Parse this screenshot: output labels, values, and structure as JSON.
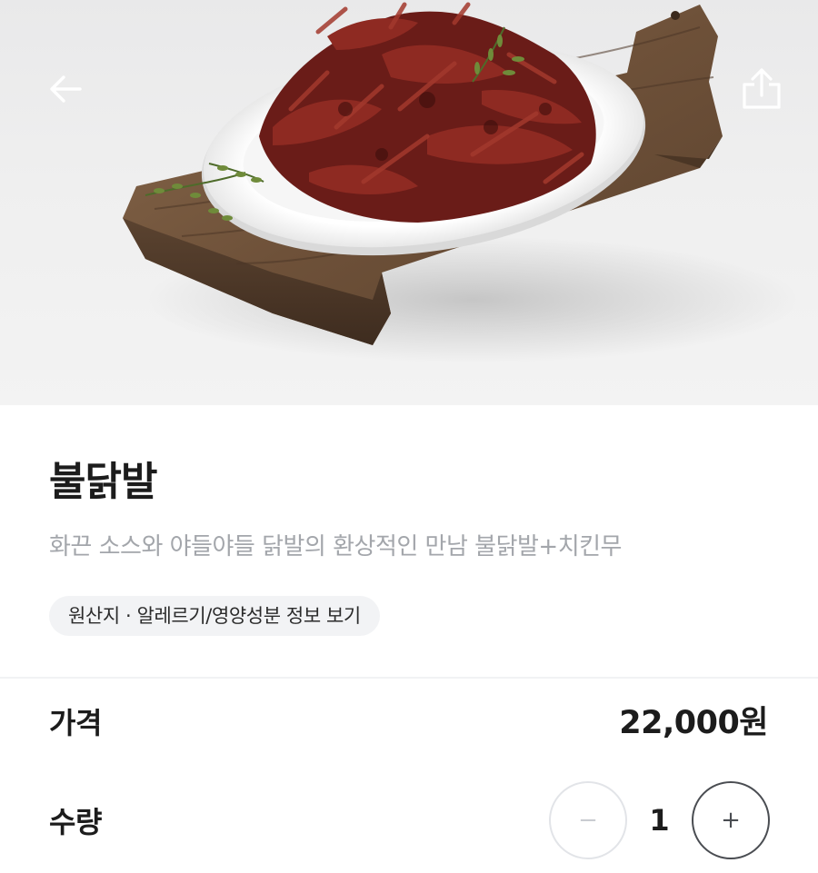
{
  "header": {
    "back_icon": "arrow-left-icon",
    "share_icon": "share-upload-icon"
  },
  "product": {
    "name": "불닭발",
    "description": "화끈 소스와 야들야들 닭발의 환상적인 만남 불닭발+치킨무",
    "info_chip": "원산지 · 알레르기/영양성분 정보 보기"
  },
  "price": {
    "label": "가격",
    "value": "22,000원"
  },
  "quantity": {
    "label": "수량",
    "value": "1",
    "minus_symbol": "−",
    "plus_symbol": "+"
  },
  "colors": {
    "text_primary": "#1c1c1c",
    "text_secondary": "#a3a6ab",
    "chip_background": "#f2f3f5",
    "divider": "#f1f2f4"
  }
}
